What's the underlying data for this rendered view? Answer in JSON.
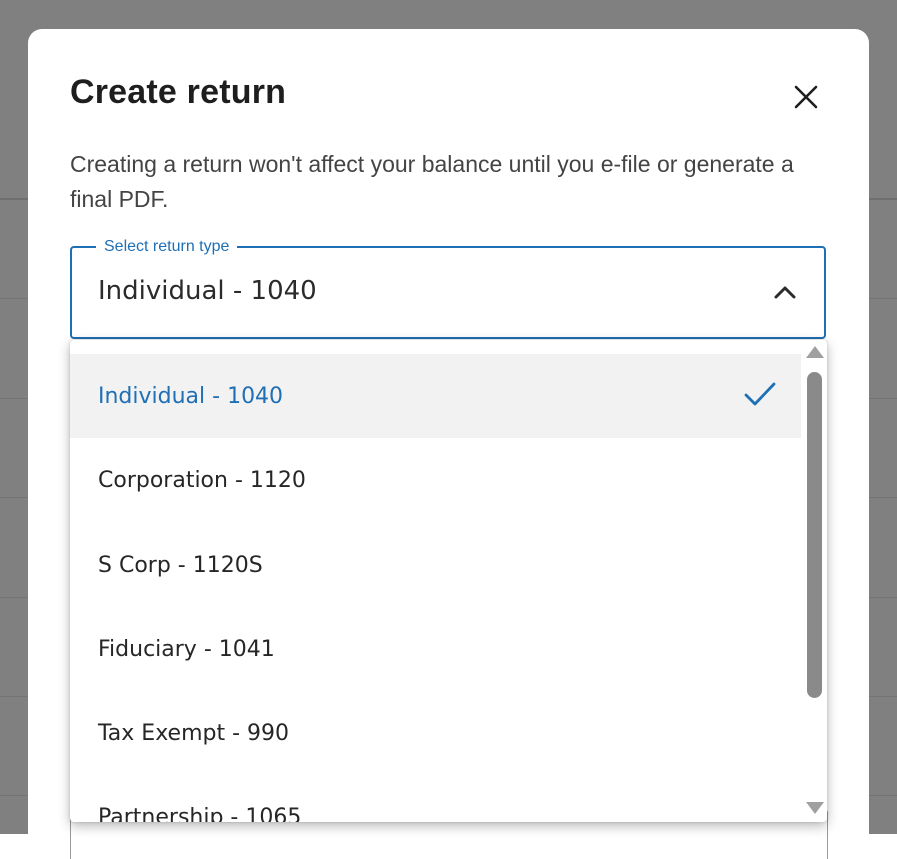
{
  "modal": {
    "title": "Create return",
    "description": "Creating a return won't affect your balance until you e-file or generate a final PDF."
  },
  "select": {
    "legend": "Select return type",
    "value": "Individual - 1040"
  },
  "dropdown": {
    "options": [
      {
        "label": "Individual - 1040",
        "selected": true
      },
      {
        "label": "Corporation - 1120",
        "selected": false
      },
      {
        "label": "S Corp - 1120S",
        "selected": false
      },
      {
        "label": "Fiduciary - 1041",
        "selected": false
      },
      {
        "label": "Tax Exempt - 990",
        "selected": false
      },
      {
        "label": "Partnership - 1065",
        "selected": false
      }
    ]
  },
  "icons": {
    "close": "close-icon",
    "chevron": "chevron-up-icon",
    "check": "check-icon"
  },
  "colors": {
    "accent": "#1f6fb5",
    "overlay": "#808080",
    "selected_bg": "#f2f2f2"
  }
}
